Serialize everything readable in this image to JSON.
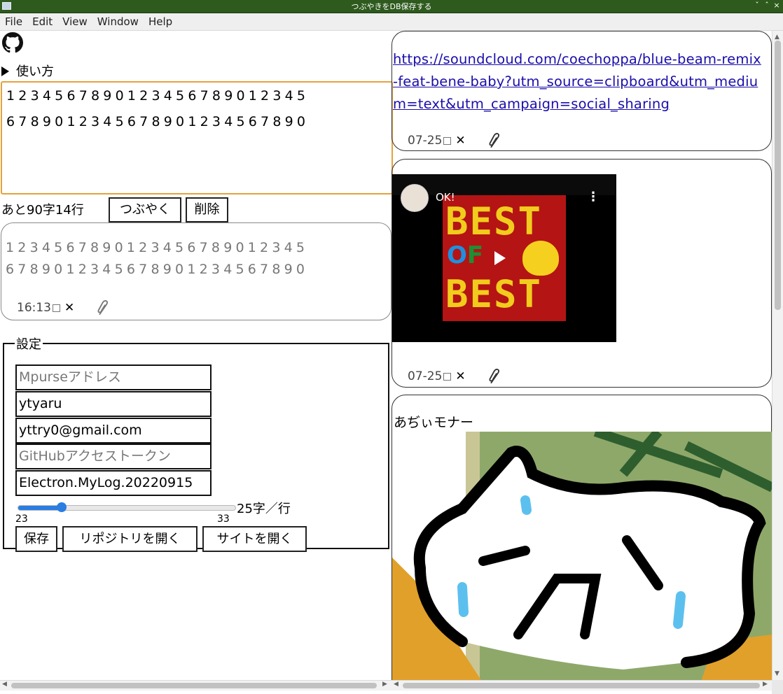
{
  "window": {
    "title": "つぶやきをDB保存する",
    "controls": [
      "ˇ",
      "ˆ",
      "×"
    ]
  },
  "menu": [
    "File",
    "Edit",
    "View",
    "Window",
    "Help"
  ],
  "left": {
    "howto_label": "使い方",
    "editor_text": "1234567890123456789012345\n6789012345678901234567890",
    "counter": "あと90字14行",
    "tweet_button": "つぶやく",
    "delete_button": "削除",
    "preview": {
      "text": "1234567890123456789012345\n6789012345678901234567890",
      "time": "16:13"
    }
  },
  "settings": {
    "legend": "設定",
    "mpurse_placeholder": "Mpurseアドレス",
    "username": "ytyaru",
    "email": "yttry0@gmail.com",
    "token_placeholder": "GitHubアクセストークン",
    "repo": "Electron.MyLog.20220915",
    "slider": {
      "min": "23",
      "max": "33",
      "value": 25,
      "label": "25字／行"
    },
    "save_button": "保存",
    "open_repo_button": "リポジトリを開く",
    "open_site_button": "サイトを開く"
  },
  "posts": [
    {
      "link": "https://soundcloud.com/coechoppa/blue-beam-remix-feat-bene-baby?utm_source=clipboard&utm_medium=text&utm_campaign=social_sharing",
      "date": "07-25"
    },
    {
      "video_title": "OK!",
      "thumb_top": "BEST",
      "thumb_mid_o": "O",
      "thumb_mid_f": "F",
      "thumb_bottom": "BEST",
      "date": "07-25"
    },
    {
      "caption": "あぢぃモナー"
    }
  ],
  "colors": {
    "titlebar": "#2e5a1e",
    "focus_border": "#e6a23c",
    "link": "#1a0dab",
    "slider": "#2a7de1"
  }
}
